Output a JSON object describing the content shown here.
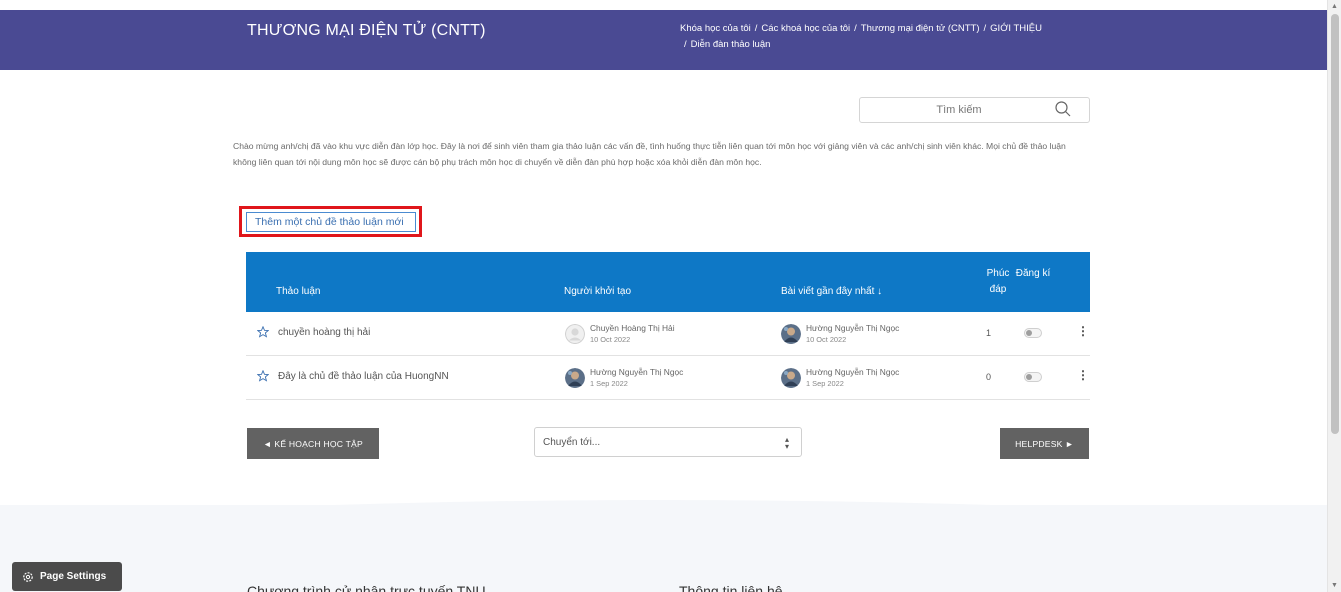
{
  "header": {
    "course_title": "THƯƠNG MẠI ĐIỆN TỬ (CNTT)",
    "breadcrumb": [
      "Khóa học của tôi",
      "Các khoá học của tôi",
      "Thương mại điện tử (CNTT)",
      "GIỚI THIỆU",
      "Diễn đàn thảo luận"
    ],
    "breadcrumb_separator": "/"
  },
  "search": {
    "placeholder": "Tìm kiếm",
    "icon": "search-icon"
  },
  "intro_text": "Chào mừng anh/chị đã vào khu vực diễn đàn lớp học. Đây là nơi để sinh viên tham gia thảo luận các vấn đề, tình huống thực tiễn liên quan tới môn học với giảng viên và các anh/chị sinh viên khác. Mọi chủ đề thảo luận không liên quan tới nội dung môn học sẽ được cán bộ phụ trách môn học di chuyển về diễn đàn phù hợp hoặc xóa khỏi diễn đàn môn học.",
  "add_topic_label": "Thêm một chủ đề thảo luận mới",
  "table": {
    "columns": {
      "topic": "Thảo luận",
      "author": "Người khởi tạo",
      "latest": "Bài viết gần đây nhất ↓",
      "replies": "Phúc đáp",
      "subscribe": "Đăng kí"
    },
    "rows": [
      {
        "topic": "chuyền hoàng thị hải",
        "author_name": "Chuyền Hoàng Thị Hải",
        "author_date": "10 Oct 2022",
        "author_avatar": "default-avatar",
        "latest_name": "Hường Nguyễn Thị Ngọc",
        "latest_date": "10 Oct 2022",
        "replies": "1",
        "subscribed": false
      },
      {
        "topic": "Đây là chủ đề thảo luận của HuongNN",
        "author_name": "Hường Nguyễn Thị Ngọc",
        "author_date": "1 Sep 2022",
        "author_avatar": "photo-avatar",
        "latest_name": "Hường Nguyễn Thị Ngọc",
        "latest_date": "1 Sep 2022",
        "replies": "0",
        "subscribed": false
      }
    ]
  },
  "navigation": {
    "prev_label": "◄ KẾ HOẠCH HỌC TẬP",
    "jump_label": "Chuyển tới...",
    "next_label": "HELPDESK ►"
  },
  "footer": {
    "col1_title": "Chương trình cử nhân trực tuyến TNU",
    "col2_title": "Thông tin liên hệ"
  },
  "page_settings_label": "Page Settings",
  "colors": {
    "header_bg": "#4a4a93",
    "table_header_bg": "#0e78c6",
    "highlight_frame": "#e0161b",
    "nav_button_bg": "#626262"
  }
}
